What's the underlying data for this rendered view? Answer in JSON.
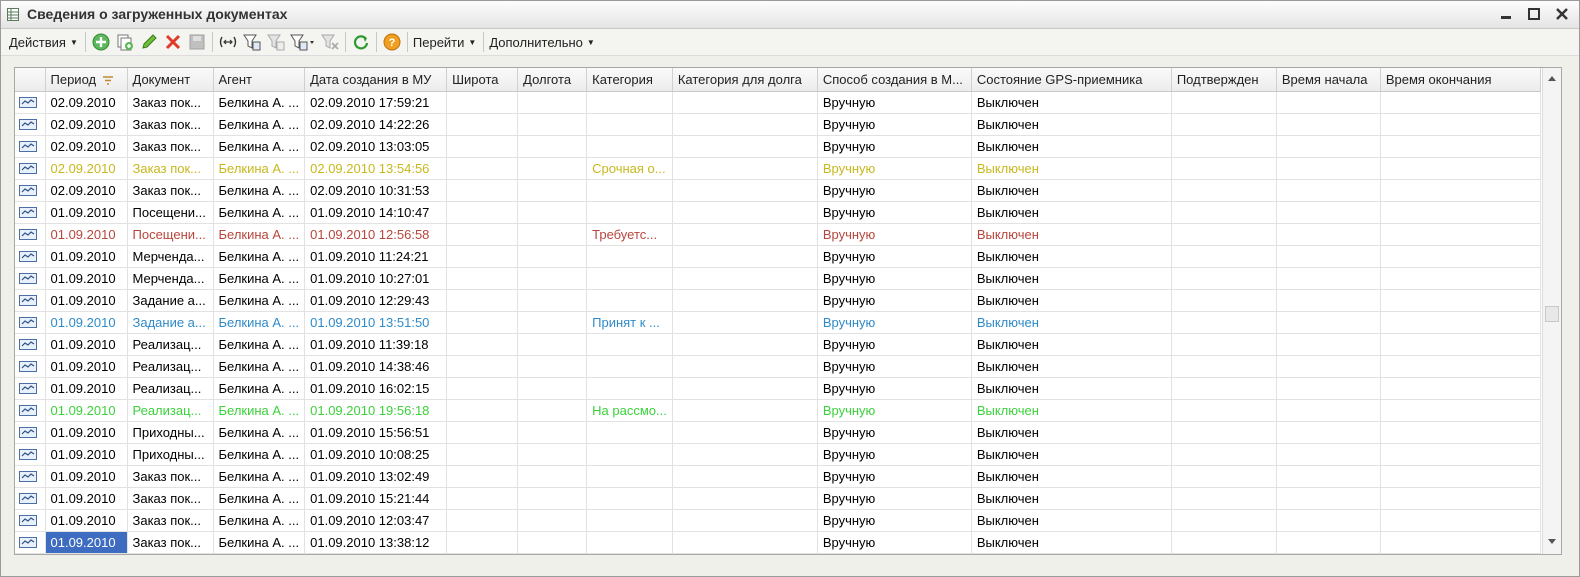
{
  "window": {
    "title": "Сведения о загруженных документах"
  },
  "toolbar": {
    "actions_label": "Действия",
    "goto_label": "Перейти",
    "more_label": "Дополнительно",
    "icons": [
      "add-icon",
      "copy-icon",
      "edit-icon",
      "delete-icon",
      "save-icon",
      "range-icon",
      "filter-icon",
      "filter-clear-icon",
      "filter-menu-icon",
      "filter-remove-icon",
      "refresh-icon",
      "help-icon"
    ]
  },
  "table": {
    "columns": [
      "",
      "Период",
      "Документ",
      "Агент",
      "Дата создания в МУ",
      "Широта",
      "Долгота",
      "Категория",
      "Категория для долга",
      "Способ создания в М...",
      "Состояние GPS-приемника",
      "Подтвержден",
      "Время начала",
      "Время окончания"
    ],
    "sorted_column": "Период",
    "selected_row": 20,
    "rows": [
      {
        "style": "normal",
        "period": "02.09.2010",
        "doc": "Заказ пок...",
        "agent": "Белкина А. ...",
        "created": "02.09.2010 17:59:21",
        "lat": "",
        "lon": "",
        "cat": "",
        "debtcat": "",
        "method": "Вручную",
        "gps": "Выключен",
        "confirmed": "",
        "start": "",
        "end": ""
      },
      {
        "style": "normal",
        "period": "02.09.2010",
        "doc": "Заказ пок...",
        "agent": "Белкина А. ...",
        "created": "02.09.2010 14:22:26",
        "lat": "",
        "lon": "",
        "cat": "",
        "debtcat": "",
        "method": "Вручную",
        "gps": "Выключен",
        "confirmed": "",
        "start": "",
        "end": ""
      },
      {
        "style": "normal",
        "period": "02.09.2010",
        "doc": "Заказ пок...",
        "agent": "Белкина А. ...",
        "created": "02.09.2010 13:03:05",
        "lat": "",
        "lon": "",
        "cat": "",
        "debtcat": "",
        "method": "Вручную",
        "gps": "Выключен",
        "confirmed": "",
        "start": "",
        "end": ""
      },
      {
        "style": "yellow",
        "period": "02.09.2010",
        "doc": "Заказ пок...",
        "agent": "Белкина А. ...",
        "created": "02.09.2010 13:54:56",
        "lat": "",
        "lon": "",
        "cat": "Срочная о...",
        "debtcat": "",
        "method": "Вручную",
        "gps": "Выключен",
        "confirmed": "",
        "start": "",
        "end": ""
      },
      {
        "style": "normal",
        "period": "02.09.2010",
        "doc": "Заказ пок...",
        "agent": "Белкина А. ...",
        "created": "02.09.2010 10:31:53",
        "lat": "",
        "lon": "",
        "cat": "",
        "debtcat": "",
        "method": "Вручную",
        "gps": "Выключен",
        "confirmed": "",
        "start": "",
        "end": ""
      },
      {
        "style": "normal",
        "period": "01.09.2010",
        "doc": "Посещени...",
        "agent": "Белкина А. ...",
        "created": "01.09.2010 14:10:47",
        "lat": "",
        "lon": "",
        "cat": "",
        "debtcat": "",
        "method": "Вручную",
        "gps": "Выключен",
        "confirmed": "",
        "start": "",
        "end": ""
      },
      {
        "style": "red",
        "period": "01.09.2010",
        "doc": "Посещени...",
        "agent": "Белкина А. ...",
        "created": "01.09.2010 12:56:58",
        "lat": "",
        "lon": "",
        "cat": "Требуетс...",
        "debtcat": "",
        "method": "Вручную",
        "gps": "Выключен",
        "confirmed": "",
        "start": "",
        "end": ""
      },
      {
        "style": "normal",
        "period": "01.09.2010",
        "doc": "Мерченда...",
        "agent": "Белкина А. ...",
        "created": "01.09.2010 11:24:21",
        "lat": "",
        "lon": "",
        "cat": "",
        "debtcat": "",
        "method": "Вручную",
        "gps": "Выключен",
        "confirmed": "",
        "start": "",
        "end": ""
      },
      {
        "style": "normal",
        "period": "01.09.2010",
        "doc": "Мерченда...",
        "agent": "Белкина А. ...",
        "created": "01.09.2010 10:27:01",
        "lat": "",
        "lon": "",
        "cat": "",
        "debtcat": "",
        "method": "Вручную",
        "gps": "Выключен",
        "confirmed": "",
        "start": "",
        "end": ""
      },
      {
        "style": "normal",
        "period": "01.09.2010",
        "doc": "Задание а...",
        "agent": "Белкина А. ...",
        "created": "01.09.2010 12:29:43",
        "lat": "",
        "lon": "",
        "cat": "",
        "debtcat": "",
        "method": "Вручную",
        "gps": "Выключен",
        "confirmed": "",
        "start": "",
        "end": ""
      },
      {
        "style": "blue",
        "period": "01.09.2010",
        "doc": "Задание а...",
        "agent": "Белкина А. ...",
        "created": "01.09.2010 13:51:50",
        "lat": "",
        "lon": "",
        "cat": "Принят к ...",
        "debtcat": "",
        "method": "Вручную",
        "gps": "Выключен",
        "confirmed": "",
        "start": "",
        "end": ""
      },
      {
        "style": "normal",
        "period": "01.09.2010",
        "doc": "Реализац...",
        "agent": "Белкина А. ...",
        "created": "01.09.2010 11:39:18",
        "lat": "",
        "lon": "",
        "cat": "",
        "debtcat": "",
        "method": "Вручную",
        "gps": "Выключен",
        "confirmed": "",
        "start": "",
        "end": ""
      },
      {
        "style": "normal",
        "period": "01.09.2010",
        "doc": "Реализац...",
        "agent": "Белкина А. ...",
        "created": "01.09.2010 14:38:46",
        "lat": "",
        "lon": "",
        "cat": "",
        "debtcat": "",
        "method": "Вручную",
        "gps": "Выключен",
        "confirmed": "",
        "start": "",
        "end": ""
      },
      {
        "style": "normal",
        "period": "01.09.2010",
        "doc": "Реализац...",
        "agent": "Белкина А. ...",
        "created": "01.09.2010 16:02:15",
        "lat": "",
        "lon": "",
        "cat": "",
        "debtcat": "",
        "method": "Вручную",
        "gps": "Выключен",
        "confirmed": "",
        "start": "",
        "end": ""
      },
      {
        "style": "green",
        "period": "01.09.2010",
        "doc": "Реализац...",
        "agent": "Белкина А. ...",
        "created": "01.09.2010 19:56:18",
        "lat": "",
        "lon": "",
        "cat": "На рассмо...",
        "debtcat": "",
        "method": "Вручную",
        "gps": "Выключен",
        "confirmed": "",
        "start": "",
        "end": ""
      },
      {
        "style": "normal",
        "period": "01.09.2010",
        "doc": "Приходны...",
        "agent": "Белкина А. ...",
        "created": "01.09.2010 15:56:51",
        "lat": "",
        "lon": "",
        "cat": "",
        "debtcat": "",
        "method": "Вручную",
        "gps": "Выключен",
        "confirmed": "",
        "start": "",
        "end": ""
      },
      {
        "style": "normal",
        "period": "01.09.2010",
        "doc": "Приходны...",
        "agent": "Белкина А. ...",
        "created": "01.09.2010 10:08:25",
        "lat": "",
        "lon": "",
        "cat": "",
        "debtcat": "",
        "method": "Вручную",
        "gps": "Выключен",
        "confirmed": "",
        "start": "",
        "end": ""
      },
      {
        "style": "normal",
        "period": "01.09.2010",
        "doc": "Заказ пок...",
        "agent": "Белкина А. ...",
        "created": "01.09.2010 13:02:49",
        "lat": "",
        "lon": "",
        "cat": "",
        "debtcat": "",
        "method": "Вручную",
        "gps": "Выключен",
        "confirmed": "",
        "start": "",
        "end": ""
      },
      {
        "style": "normal",
        "period": "01.09.2010",
        "doc": "Заказ пок...",
        "agent": "Белкина А. ...",
        "created": "01.09.2010 15:21:44",
        "lat": "",
        "lon": "",
        "cat": "",
        "debtcat": "",
        "method": "Вручную",
        "gps": "Выключен",
        "confirmed": "",
        "start": "",
        "end": ""
      },
      {
        "style": "normal",
        "period": "01.09.2010",
        "doc": "Заказ пок...",
        "agent": "Белкина А. ...",
        "created": "01.09.2010 12:03:47",
        "lat": "",
        "lon": "",
        "cat": "",
        "debtcat": "",
        "method": "Вручную",
        "gps": "Выключен",
        "confirmed": "",
        "start": "",
        "end": ""
      },
      {
        "style": "normal",
        "period": "01.09.2010",
        "doc": "Заказ пок...",
        "agent": "Белкина А. ...",
        "created": "01.09.2010 13:38:12",
        "lat": "",
        "lon": "",
        "cat": "",
        "debtcat": "",
        "method": "Вручную",
        "gps": "Выключен",
        "confirmed": "",
        "start": "",
        "end": ""
      }
    ]
  }
}
